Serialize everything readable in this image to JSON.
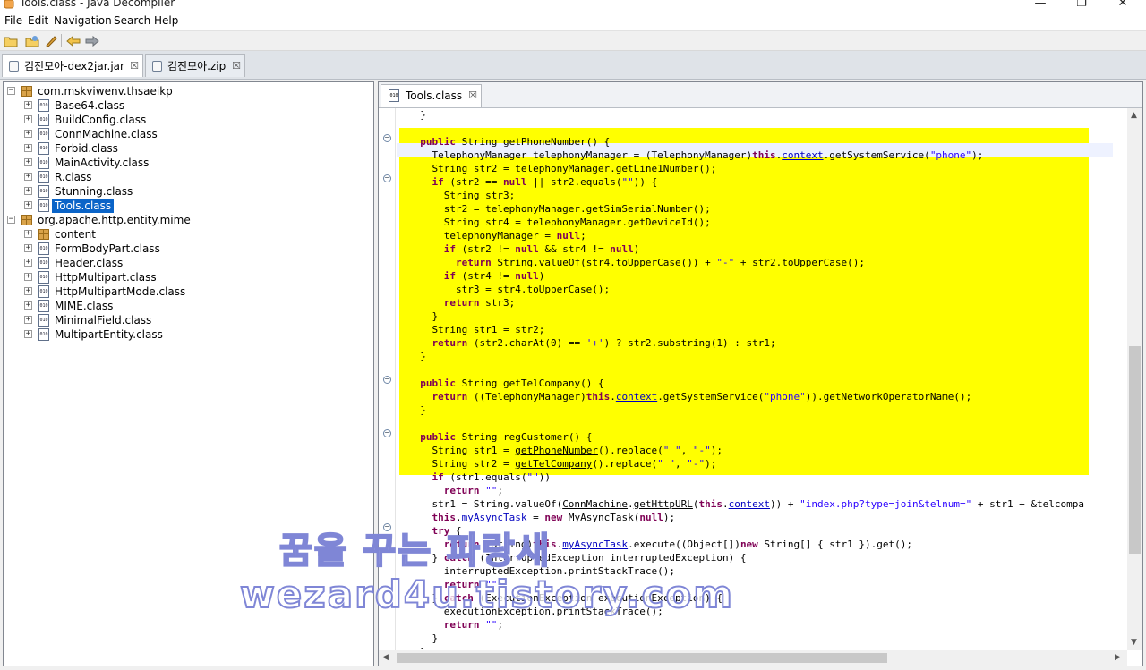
{
  "window": {
    "title": "Tools.class - Java Decompiler",
    "controls": [
      "—",
      "❐",
      "✕"
    ]
  },
  "menu": [
    "File",
    "Edit",
    "Navigation",
    "Search",
    "Help"
  ],
  "toolbar": {
    "icons": [
      "open-file-icon",
      "open-type-icon",
      "run-icon",
      "back-icon",
      "forward-icon"
    ]
  },
  "file_tabs": [
    {
      "label": "검진모아-dex2jar.jar",
      "active": true
    },
    {
      "label": "검진모아.zip",
      "active": false
    }
  ],
  "tree": [
    {
      "label": "com.mskviwenv.thsaeikp",
      "kind": "package",
      "level": 0,
      "exp": "−"
    },
    {
      "label": "Base64.class",
      "kind": "class",
      "level": 1,
      "exp": "+"
    },
    {
      "label": "BuildConfig.class",
      "kind": "class",
      "level": 1,
      "exp": "+"
    },
    {
      "label": "ConnMachine.class",
      "kind": "class",
      "level": 1,
      "exp": "+"
    },
    {
      "label": "Forbid.class",
      "kind": "class",
      "level": 1,
      "exp": "+"
    },
    {
      "label": "MainActivity.class",
      "kind": "class",
      "level": 1,
      "exp": "+"
    },
    {
      "label": "R.class",
      "kind": "class",
      "level": 1,
      "exp": "+"
    },
    {
      "label": "Stunning.class",
      "kind": "class",
      "level": 1,
      "exp": "+"
    },
    {
      "label": "Tools.class",
      "kind": "class",
      "level": 1,
      "exp": "+",
      "selected": true
    },
    {
      "label": "org.apache.http.entity.mime",
      "kind": "package",
      "level": 0,
      "exp": "−"
    },
    {
      "label": "content",
      "kind": "package",
      "level": 1,
      "exp": "+"
    },
    {
      "label": "FormBodyPart.class",
      "kind": "class",
      "level": 1,
      "exp": "+"
    },
    {
      "label": "Header.class",
      "kind": "class",
      "level": 1,
      "exp": "+"
    },
    {
      "label": "HttpMultipart.class",
      "kind": "class",
      "level": 1,
      "exp": "+"
    },
    {
      "label": "HttpMultipartMode.class",
      "kind": "class",
      "level": 1,
      "exp": "+"
    },
    {
      "label": "MIME.class",
      "kind": "class",
      "level": 1,
      "exp": "+"
    },
    {
      "label": "MinimalField.class",
      "kind": "class",
      "level": 1,
      "exp": "+"
    },
    {
      "label": "MultipartEntity.class",
      "kind": "class",
      "level": 1,
      "exp": "+"
    }
  ],
  "class_icon_text": "010",
  "editor_tab": {
    "label": "Tools.class"
  },
  "code_lines": [
    "  }",
    "",
    "  public String getPhoneNumber() {",
    "    TelephonyManager telephonyManager = (TelephonyManager)this.context.getSystemService(\"phone\");",
    "    String str2 = telephonyManager.getLine1Number();",
    "    if (str2 == null || str2.equals(\"\")) {",
    "      String str3;",
    "      str2 = telephonyManager.getSimSerialNumber();",
    "      String str4 = telephonyManager.getDeviceId();",
    "      telephonyManager = null;",
    "      if (str2 != null && str4 != null)",
    "        return String.valueOf(str4.toUpperCase()) + \"-\" + str2.toUpperCase();",
    "      if (str4 != null)",
    "        str3 = str4.toUpperCase();",
    "      return str3;",
    "    }",
    "    String str1 = str2;",
    "    return (str2.charAt(0) == '+') ? str2.substring(1) : str1;",
    "  }",
    "",
    "  public String getTelCompany() {",
    "    return ((TelephonyManager)this.context.getSystemService(\"phone\")).getNetworkOperatorName();",
    "  }",
    "",
    "  public String regCustomer() {",
    "    String str1 = getPhoneNumber().replace(\" \", \"-\");",
    "    String str2 = getTelCompany().replace(\" \", \"-\");",
    "    if (str1.equals(\"\"))",
    "      return \"\";",
    "    str1 = String.valueOf(ConnMachine.getHttpURL(this.context)) + \"index.php?type=join&telnum=\" + str1 + \"&telcompa",
    "    this.myAsyncTask = new MyAsyncTask(null);",
    "    try {",
    "      return (String)this.myAsyncTask.execute((Object[])new String[] { str1 }).get();",
    "    } catch (InterruptedException interruptedException) {",
    "      interruptedException.printStackTrace();",
    "      return \"\";",
    "    } catch (ExecutionException executionException) {",
    "      executionException.printStackTrace();",
    "      return \"\";",
    "    }",
    "  }"
  ],
  "watermark": {
    "line1": "꿈을 꾸는 파랑새",
    "line2": "wezard4u.tistory.com"
  }
}
